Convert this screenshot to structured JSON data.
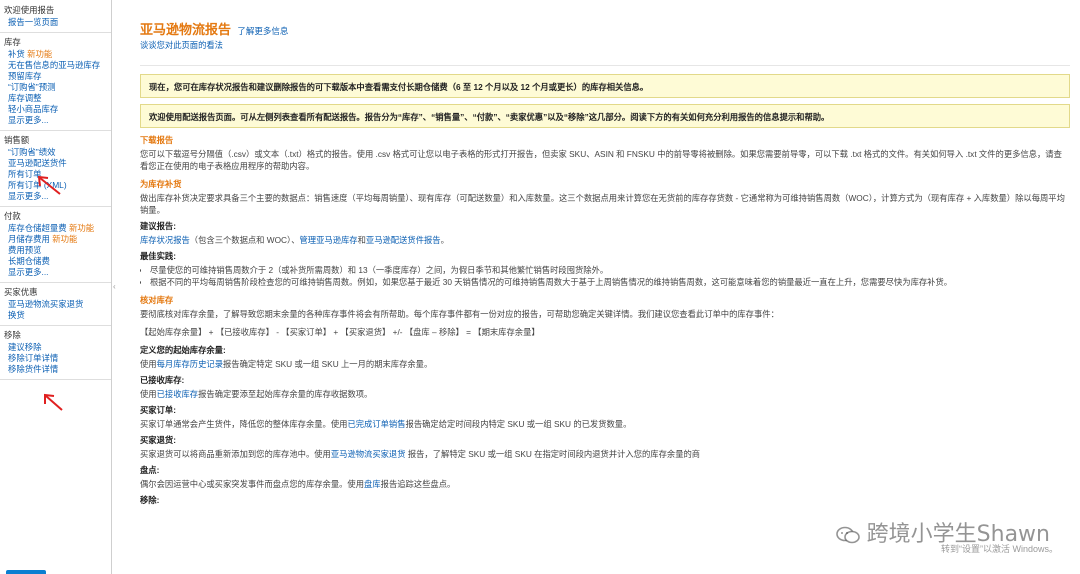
{
  "sidebar": {
    "welcome": {
      "head": "欢迎使用报告",
      "items": [
        "报告一览页面"
      ]
    },
    "inventory": {
      "head": "库存",
      "items": [
        {
          "label": "补货",
          "badge": "新功能"
        },
        {
          "label": "无在售信息的亚马逊库存",
          "badge": ""
        },
        {
          "label": "预留库存",
          "badge": ""
        },
        {
          "label": "“订购省”预测",
          "badge": ""
        },
        {
          "label": "库存调整",
          "badge": ""
        },
        {
          "label": "轻小商品库存",
          "badge": ""
        }
      ],
      "more": "显示更多..."
    },
    "sales": {
      "head": "销售额",
      "items": [
        "“订购省”绩效",
        "亚马逊配送货件",
        "所有订单",
        "所有订单 (XML)"
      ],
      "more": "显示更多..."
    },
    "payments": {
      "head": "付款",
      "items": [
        {
          "label": "库存仓储超量费",
          "badge": "新功能"
        },
        {
          "label": "月储存费用",
          "badge": "新功能"
        },
        {
          "label": "费用预览",
          "badge": ""
        },
        {
          "label": "长期仓储费",
          "badge": ""
        }
      ],
      "more": "显示更多..."
    },
    "concessions": {
      "head": "买家优惠",
      "items": [
        "亚马逊物流买家退货",
        "换货"
      ]
    },
    "removals": {
      "head": "移除",
      "items": [
        "建议移除",
        "移除订单详情",
        "移除货件详情"
      ]
    }
  },
  "header": {
    "title": "亚马逊物流报告",
    "learn_more": "了解更多信息",
    "feedback": "谈谈您对此页面的看法"
  },
  "notices": [
    "现在，您可在库存状况报告和建议删除报告的可下载版本中查看需支付长期仓储费（6 至 12 个月以及 12 个月或更长）的库存相关信息。",
    "欢迎使用配送报告页面。可从左侧列表查看所有配送报告。报告分为“库存”、“销售量”、“付款”、“卖家优惠”以及“移除”这几部分。阅读下方的有关如何充分利用报告的信息提示和帮助。"
  ],
  "sections": {
    "download": {
      "title": "下载报告",
      "text": "您可以下载逗号分隔值（.csv）或文本（.txt）格式的报告。使用 .csv 格式可让您以电子表格的形式打开报告，但卖家 SKU、ASIN 和 FNSKU 中的前导零将被删除。如果您需要前导零，可以下载 .txt 格式的文件。有关如何导入 .txt 文件的更多信息，请查看您正在使用的电子表格应用程序的帮助内容。"
    },
    "replenish": {
      "title": "为库存补货",
      "text": "做出库存补货决定要求具备三个主要的数据点：销售速度（平均每周销量）、现有库存（可配送数量）和入库数量。这三个数据点用来计算您在无货前的库存存货数 - 它通常称为可维持销售周数（WOC），计算方式为（现有库存 + 入库数量）除以每周平均销量。",
      "recommended_head": "建议报告:",
      "rec_link1": "库存状况报告",
      "rec_mid": "（包含三个数据点和 WOC）、",
      "rec_link2": "管理亚马逊库存",
      "rec_and": "和",
      "rec_link3": "亚马逊配送货件报告",
      "rec_end": "。",
      "best_head": "最佳实践:",
      "bullets": [
        "尽量使您的可维持销售周数介于 2（或补货所需周数）和 13（一季度库存）之间，为假日季节和其他繁忙销售时段囤货除外。",
        "根据不同的平均每周销售阶段检查您的可维持销售周数。例如，如果您基于最近 30 天销售情况的可维持销售周数大于基于上周销售情况的维持销售周数，这可能意味着您的销量最近一直在上升，您需要尽快为库存补货。"
      ]
    },
    "reconcile": {
      "title": "核对库存",
      "text": "要彻底核对库存余量，了解导致您期末余量的各种库存事件将会有所帮助。每个库存事件都有一份对应的报告，可帮助您确定关键详情。我们建议您查看此订单中的库存事件：",
      "formula": "【起始库存余量】 + 【已接收库存】 - 【买家订单】 + 【买家退货】 +/- 【盘库 – 移除】 = 【期末库存余量】",
      "items": [
        {
          "head": "定义您的起始库存余量:",
          "pre": "使用",
          "link": "每月库存历史记录",
          "post": "报告确定特定 SKU 或一组 SKU 上一月的期末库存余量。"
        },
        {
          "head": "已接收库存:",
          "pre": "使用",
          "link": "已接收库存",
          "post": "报告确定要添至起始库存余量的库存收据数项。"
        },
        {
          "head": "买家订单:",
          "pre": "买家订单通常会产生货件，降低您的整体库存余量。使用",
          "link": "已完成订单销售",
          "post": "报告确定给定时间段内特定 SKU 或一组 SKU 的已发货数量。"
        },
        {
          "head": "买家退货:",
          "pre": "买家退货可以将商品重新添加到您的库存池中。使用",
          "link": "亚马逊物流买家退货",
          "post": " 报告，了解特定 SKU 或一组 SKU 在指定时间段内退货并计入您的库存余量的商"
        },
        {
          "head": "盘点:",
          "pre": "偶尔会因运营中心或买家突发事件而盘点您的库存余量。使用",
          "link": "盘库",
          "post": "报告追踪这些盘点。"
        },
        {
          "head": "移除:",
          "pre": "",
          "link": "",
          "post": ""
        }
      ]
    }
  },
  "watermark": "跨境小学生Shawn",
  "windows_notice": "转到“设置”以激活 Windows。"
}
